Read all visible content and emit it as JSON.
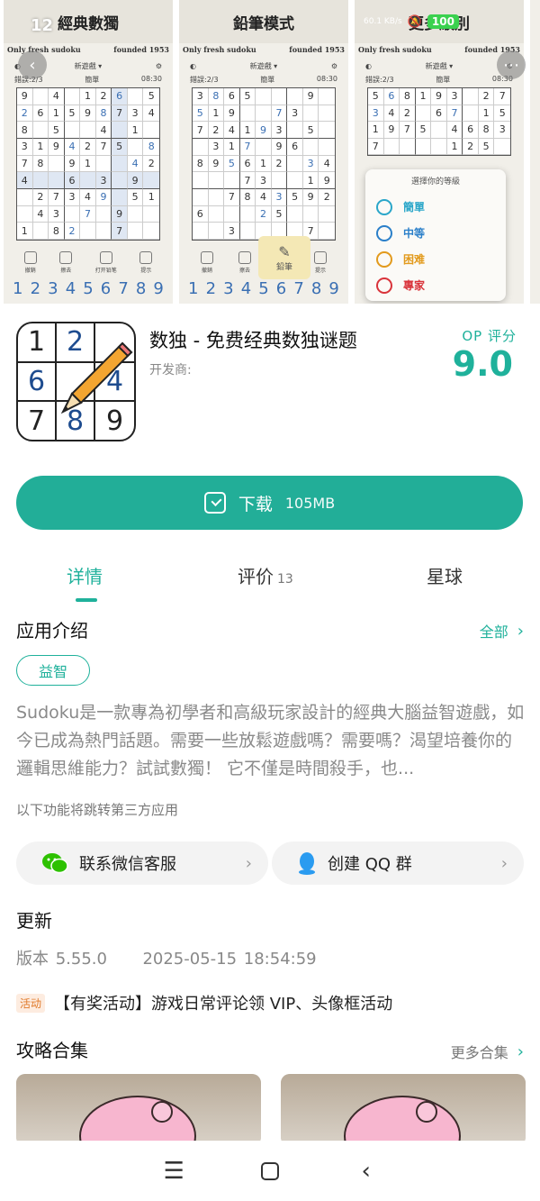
{
  "status": {
    "time": "12",
    "net_speed": "60.1 KB/s",
    "battery": "100"
  },
  "screenshots": [
    {
      "title": "經典數獨",
      "brand_left": "Only fresh sudoku",
      "brand_right": "founded 1953",
      "new_game": "新遊戲 ▾",
      "errors": "錯誤:2/3",
      "difficulty": "簡單",
      "timer": "08:30",
      "actions": [
        "撤銷",
        "擦去",
        "打开铅笔",
        "提示"
      ],
      "numbers": [
        "1",
        "2",
        "3",
        "4",
        "5",
        "6",
        "7",
        "8",
        "9"
      ],
      "board": [
        [
          "9",
          "",
          "4",
          "",
          "1",
          "2",
          "6",
          "",
          "5"
        ],
        [
          "2",
          "6",
          "1",
          "5",
          "9",
          "8",
          "7",
          "3",
          "4"
        ],
        [
          "8",
          "",
          "5",
          "",
          "",
          "4",
          "",
          "1",
          ""
        ],
        [
          "3",
          "1",
          "9",
          "4",
          "2",
          "7",
          "5",
          "",
          "8"
        ],
        [
          "7",
          "8",
          "",
          "9",
          "1",
          "",
          "",
          "4",
          "2"
        ],
        [
          "4",
          "",
          "",
          "6",
          "",
          "3",
          "",
          "9",
          ""
        ],
        [
          "",
          "2",
          "7",
          "3",
          "4",
          "9",
          "",
          "5",
          "1"
        ],
        [
          "",
          "4",
          "3",
          "",
          "7",
          "",
          "9",
          "",
          ""
        ],
        [
          "1",
          "",
          "8",
          "2",
          "",
          "",
          "7",
          "",
          ""
        ]
      ]
    },
    {
      "title": "鉛筆模式",
      "brand_left": "Only fresh sudoku",
      "brand_right": "founded 1953",
      "new_game": "新遊戲 ▾",
      "errors": "錯誤:2/3",
      "difficulty": "簡單",
      "timer": "08:30",
      "actions": [
        "撤銷",
        "擦去",
        "鉛筆",
        "提示"
      ],
      "pencil_label": "鉛筆",
      "numbers": [
        "1",
        "2",
        "3",
        "4",
        "5",
        "6",
        "7",
        "8",
        "9"
      ],
      "board": [
        [
          "3",
          "8",
          "6",
          "5",
          "",
          "",
          "",
          "9",
          ""
        ],
        [
          "5",
          "1",
          "9",
          "",
          "",
          "7",
          "3",
          "",
          ""
        ],
        [
          "7",
          "2",
          "4",
          "1",
          "9",
          "3",
          "",
          "5",
          ""
        ],
        [
          "",
          "3",
          "1",
          "7",
          "",
          "9",
          "6",
          "",
          ""
        ],
        [
          "8",
          "9",
          "5",
          "6",
          "1",
          "2",
          "",
          "3",
          "4"
        ],
        [
          "",
          "",
          "",
          "7",
          "3",
          "",
          "",
          "1",
          "9"
        ],
        [
          "",
          "",
          "7",
          "8",
          "4",
          "3",
          "5",
          "9",
          "2"
        ],
        [
          "6",
          "",
          "",
          "",
          "2",
          "5",
          "",
          "",
          ""
        ],
        [
          "",
          "",
          "3",
          "",
          "",
          "",
          "",
          "7",
          ""
        ]
      ]
    },
    {
      "title": "更多級別",
      "brand_left": "Only fresh sudoku",
      "brand_right": "founded 1953",
      "new_game": "新遊戲 ▾",
      "errors": "錯誤:2/3",
      "difficulty": "簡單",
      "timer": "08:30",
      "level_title": "選擇你的等級",
      "levels": [
        {
          "label": "簡單",
          "color": "#2aa6c9"
        },
        {
          "label": "中等",
          "color": "#2a7fc9"
        },
        {
          "label": "困难",
          "color": "#e29a1c"
        },
        {
          "label": "專家",
          "color": "#d9333a"
        }
      ],
      "board": [
        [
          "5",
          "6",
          "8",
          "1",
          "9",
          "3",
          "",
          "2",
          "7"
        ],
        [
          "3",
          "4",
          "2",
          "",
          "6",
          "7",
          "",
          "1",
          "5"
        ],
        [
          "1",
          "9",
          "7",
          "5",
          "",
          "4",
          "6",
          "8",
          "3"
        ],
        [
          "7",
          "",
          "",
          "",
          "",
          "1",
          "2",
          "5",
          ""
        ]
      ]
    }
  ],
  "app": {
    "title": "数独 - 免费经典数独谜题",
    "developer": "开发商:",
    "score_label": "OP 评分",
    "score": "9.0",
    "icon_digits": [
      "1",
      "2",
      "",
      "6",
      "",
      "4",
      "7",
      "8",
      "9"
    ]
  },
  "download": {
    "label": "下载",
    "size": "105MB"
  },
  "tabs": [
    {
      "label": "详情",
      "count": ""
    },
    {
      "label": "评价",
      "count": "13"
    },
    {
      "label": "星球",
      "count": ""
    }
  ],
  "intro": {
    "title": "应用介绍",
    "all_link": "全部",
    "tag": "益智",
    "text": "Sudoku是一款專為初學者和高級玩家設計的經典大腦益智遊戲，如今已成為熱門話題。需要一些放鬆遊戲嗎？需要嗎？渴望培養你的邏輯思維能力？試試數獨！ 它不僅是時間殺手，也...",
    "third_party_note": "以下功能将跳转第三方应用"
  },
  "services": [
    {
      "label": "联系微信客服"
    },
    {
      "label": "创建 QQ 群"
    }
  ],
  "update": {
    "title": "更新",
    "version": "版本 5.55.0",
    "date": "2025-05-15 18:54:59"
  },
  "activity": {
    "badge": "活动",
    "text": "【有奖活动】游戏日常评论领 VIP、头像框活动"
  },
  "guides": {
    "title": "攻略合集",
    "more": "更多合集"
  },
  "colors": {
    "accent": "#22ae98",
    "sudoku_blue": "#3a6fb3"
  }
}
